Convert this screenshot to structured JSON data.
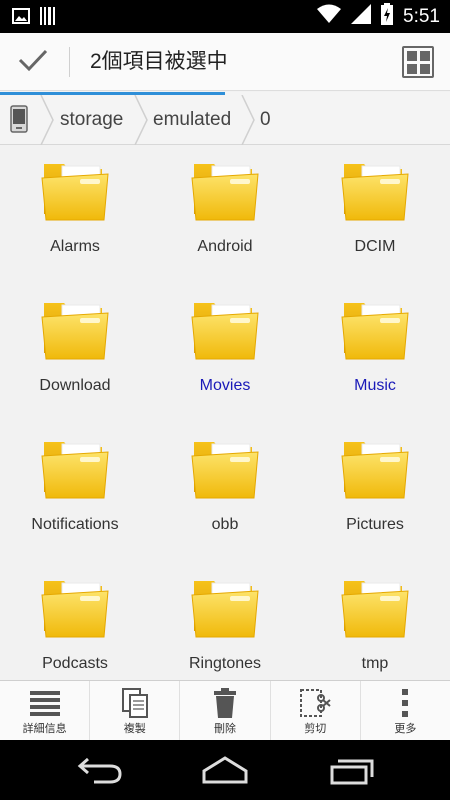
{
  "status_bar": {
    "time": "5:51",
    "icons": [
      "image-icon",
      "barcode-icon",
      "wifi-icon",
      "signal-icon",
      "battery-charging-icon"
    ]
  },
  "action_bar": {
    "title": "2個項目被選中",
    "confirm_icon": "checkmark-icon",
    "view_toggle_icon": "grid-view-icon"
  },
  "breadcrumb": {
    "root_icon": "phone-icon",
    "items": [
      "storage",
      "emulated",
      "0"
    ]
  },
  "folders": [
    {
      "name": "Alarms",
      "selected": false
    },
    {
      "name": "Android",
      "selected": false
    },
    {
      "name": "DCIM",
      "selected": false
    },
    {
      "name": "Download",
      "selected": false
    },
    {
      "name": "Movies",
      "selected": true
    },
    {
      "name": "Music",
      "selected": true
    },
    {
      "name": "Notifications",
      "selected": false
    },
    {
      "name": "obb",
      "selected": false
    },
    {
      "name": "Pictures",
      "selected": false
    },
    {
      "name": "Podcasts",
      "selected": false
    },
    {
      "name": "Ringtones",
      "selected": false
    },
    {
      "name": "tmp",
      "selected": false
    }
  ],
  "toolbar": {
    "items": [
      {
        "label": "詳細信息",
        "icon": "details-list-icon"
      },
      {
        "label": "複製",
        "icon": "copy-icon"
      },
      {
        "label": "刪除",
        "icon": "trash-icon"
      },
      {
        "label": "剪切",
        "icon": "cut-icon"
      },
      {
        "label": "更多",
        "icon": "more-vertical-icon"
      }
    ]
  },
  "nav_bar": {
    "icons": [
      "back-icon",
      "home-icon",
      "recents-icon"
    ]
  },
  "colors": {
    "selected_text": "#1a1ab8",
    "folder_yellow": "#f7cc1c",
    "accent_blue": "#2f8fd8"
  }
}
